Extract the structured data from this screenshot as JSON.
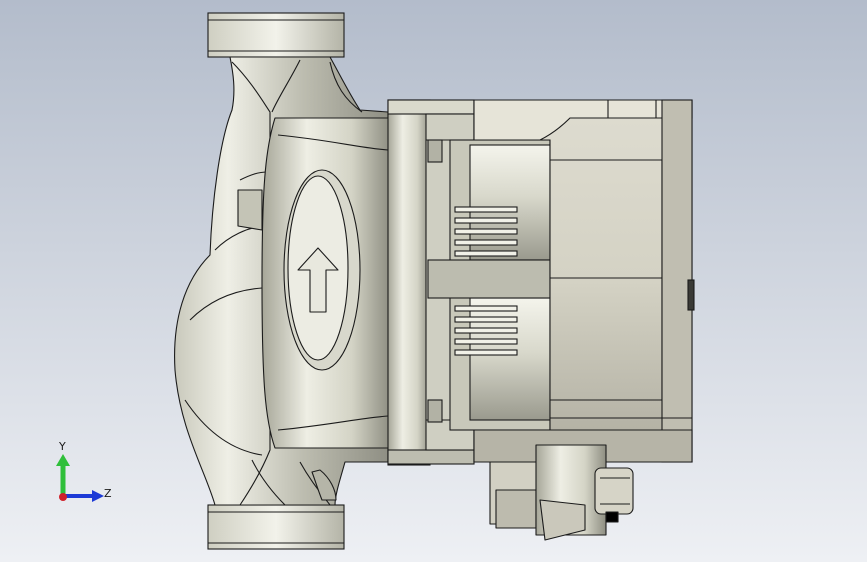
{
  "viewport": {
    "background_top": "#b3bccb",
    "background_bottom": "#eef0f4"
  },
  "model": {
    "part": "circulation-pump",
    "flow_direction": "up",
    "body_color": "#dcdccf",
    "edge_color": "#1b1b1b",
    "shadow_color": "#7e7e74"
  },
  "triad": {
    "y_label": "Y",
    "z_label": "Z",
    "y_color": "#2fbf3a",
    "z_color": "#1c3ad6",
    "origin_color": "#d0202a"
  }
}
